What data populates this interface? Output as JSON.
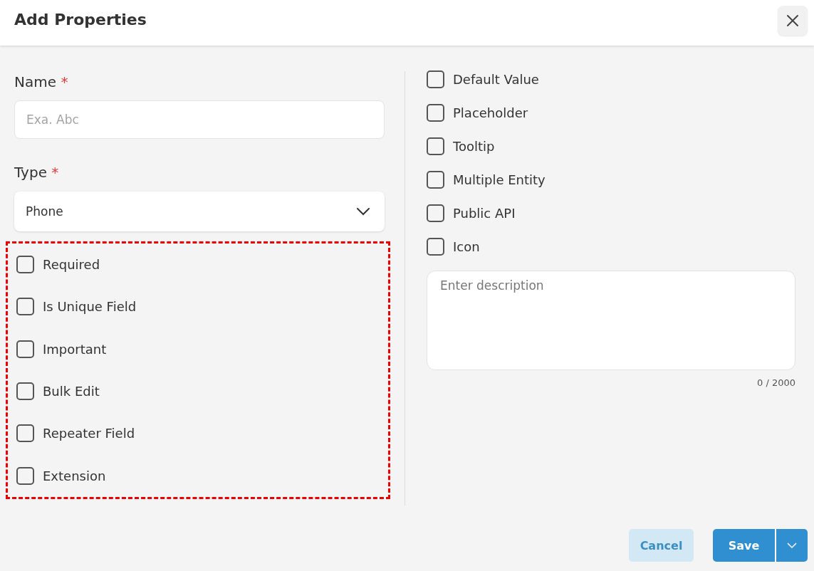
{
  "dialog": {
    "title": "Add Properties"
  },
  "name_field": {
    "label": "Name",
    "required_mark": "*",
    "placeholder": "Exa. Abc"
  },
  "type_field": {
    "label": "Type",
    "required_mark": "*",
    "value": "Phone"
  },
  "left_options": {
    "highlighted": true,
    "items": [
      {
        "label": "Required",
        "checked": false
      },
      {
        "label": "Is Unique Field",
        "checked": false
      },
      {
        "label": "Important",
        "checked": false
      },
      {
        "label": "Bulk Edit",
        "checked": false
      },
      {
        "label": "Repeater Field",
        "checked": false
      },
      {
        "label": "Extension",
        "checked": false
      }
    ]
  },
  "right_options": [
    {
      "label": "Default Value",
      "checked": false
    },
    {
      "label": "Placeholder",
      "checked": false
    },
    {
      "label": "Tooltip",
      "checked": false
    },
    {
      "label": "Multiple Entity",
      "checked": false
    },
    {
      "label": "Public API",
      "checked": false
    },
    {
      "label": "Icon",
      "checked": false
    }
  ],
  "description": {
    "placeholder": "Enter description",
    "counter": "0 / 2000"
  },
  "buttons": {
    "cancel": "Cancel",
    "save": "Save"
  }
}
